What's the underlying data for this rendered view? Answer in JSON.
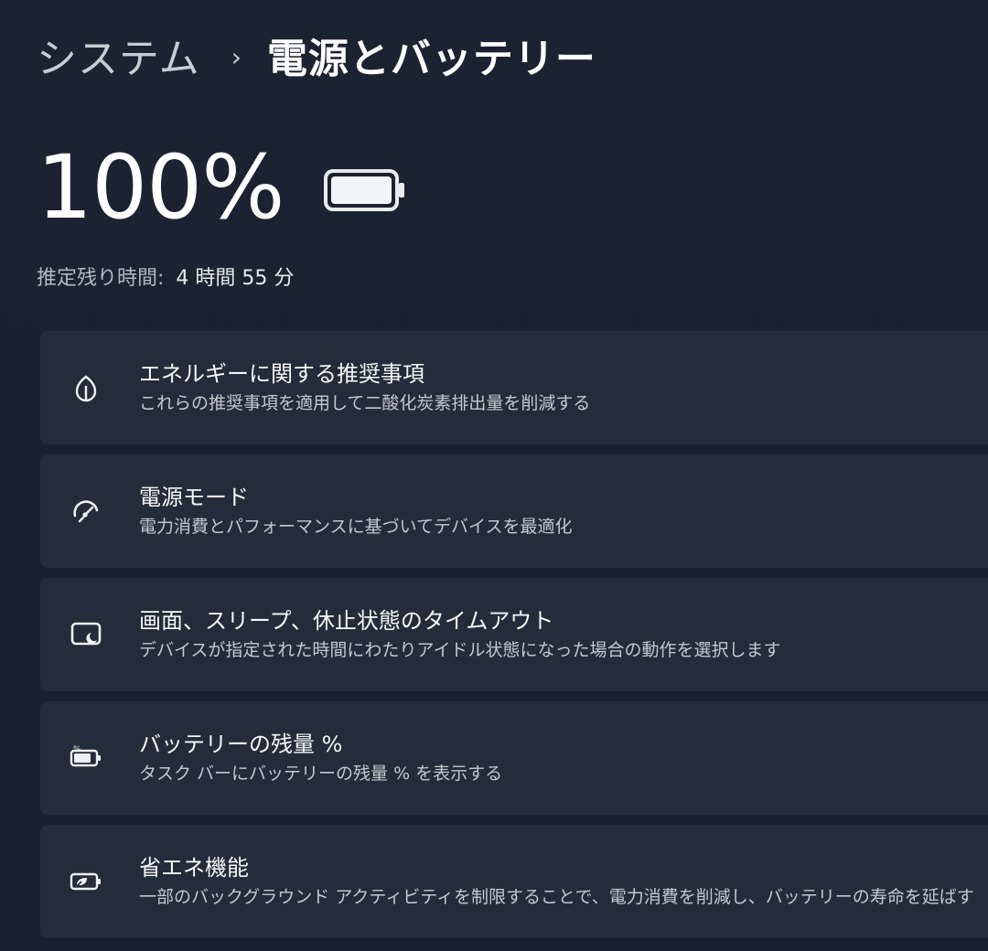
{
  "breadcrumb": {
    "parent": "システム",
    "separator": "›",
    "current": "電源とバッテリー"
  },
  "battery": {
    "percent_text": "100%",
    "level_percent": 100
  },
  "estimate": {
    "label": "推定残り時間:",
    "value": "4 時間 55 分"
  },
  "cards": [
    {
      "icon": "leaf-icon",
      "title": "エネルギーに関する推奨事項",
      "desc": "これらの推奨事項を適用して二酸化炭素排出量を削減する"
    },
    {
      "icon": "power-mode-icon",
      "title": "電源モード",
      "desc": "電力消費とパフォーマンスに基づいてデバイスを最適化"
    },
    {
      "icon": "screen-sleep-icon",
      "title": "画面、スリープ、休止状態のタイムアウト",
      "desc": "デバイスが指定された時間にわたりアイドル状態になった場合の動作を選択します"
    },
    {
      "icon": "battery-percent-icon",
      "title": "バッテリーの残量 %",
      "desc": "タスク バーにバッテリーの残量 % を表示する"
    },
    {
      "icon": "battery-saver-icon",
      "title": "省エネ機能",
      "desc": "一部のバックグラウンド アクティビティを制限することで、電力消費を削減し、バッテリーの寿命を延ばす"
    }
  ],
  "colors": {
    "background": "#1c2130",
    "card": "#262b3b",
    "text_primary": "#f5f6f8",
    "text_secondary": "#c4c7cf"
  }
}
